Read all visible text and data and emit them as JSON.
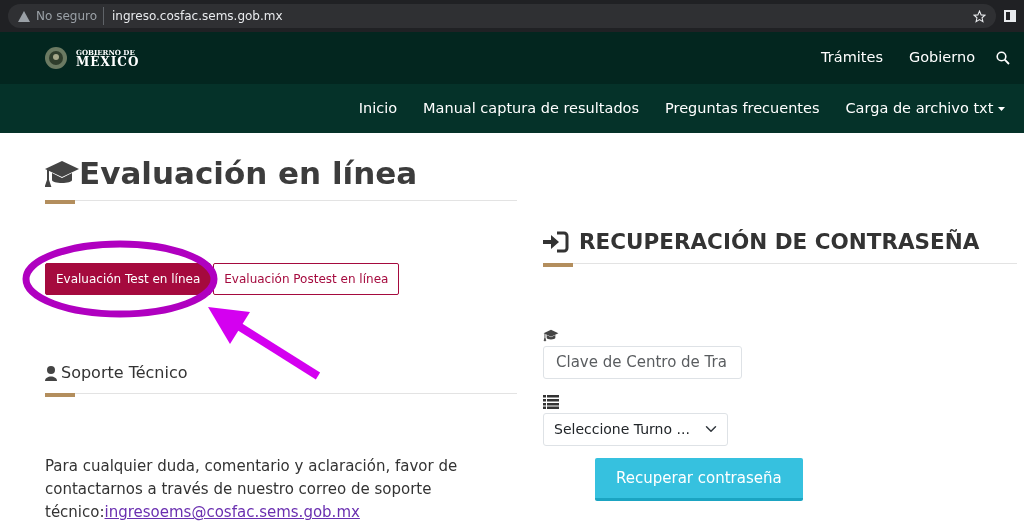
{
  "browser": {
    "security": "No seguro",
    "url": "ingreso.cosfac.sems.gob.mx"
  },
  "top_nav": {
    "logo_top": "GOBIERNO DE",
    "logo_bottom": "MÉXICO",
    "links": [
      "Trámites",
      "Gobierno"
    ]
  },
  "sub_nav": {
    "links": [
      {
        "label": "Inicio",
        "dropdown": false
      },
      {
        "label": "Manual captura de resultados",
        "dropdown": false
      },
      {
        "label": "Preguntas frecuentes",
        "dropdown": false
      },
      {
        "label": "Carga de archivo txt",
        "dropdown": true
      }
    ]
  },
  "evaluation": {
    "title": "Evaluación en línea",
    "buttons": [
      {
        "label": "Evaluación Test en línea",
        "selected": true
      },
      {
        "label": "Evaluación Postest en línea",
        "selected": false
      }
    ]
  },
  "support": {
    "title": "Soporte Técnico",
    "text": "Para cualquier duda, comentario y aclaración, favor de contactarnos a través de nuestro correo de soporte técnico:",
    "email": "ingresoems@cosfac.sems.gob.mx"
  },
  "recovery": {
    "title": "RECUPERACIÓN DE CONTRASEÑA",
    "key_field": {
      "placeholder": "Clave de Centro de Tra"
    },
    "shift_select": {
      "value": "Seleccione Turno ..."
    },
    "submit": "Recuperar contraseña"
  },
  "annotations": [
    {
      "kind": "ellipse",
      "color": "#b000c0"
    },
    {
      "kind": "arrow",
      "color": "#d400f0"
    }
  ]
}
